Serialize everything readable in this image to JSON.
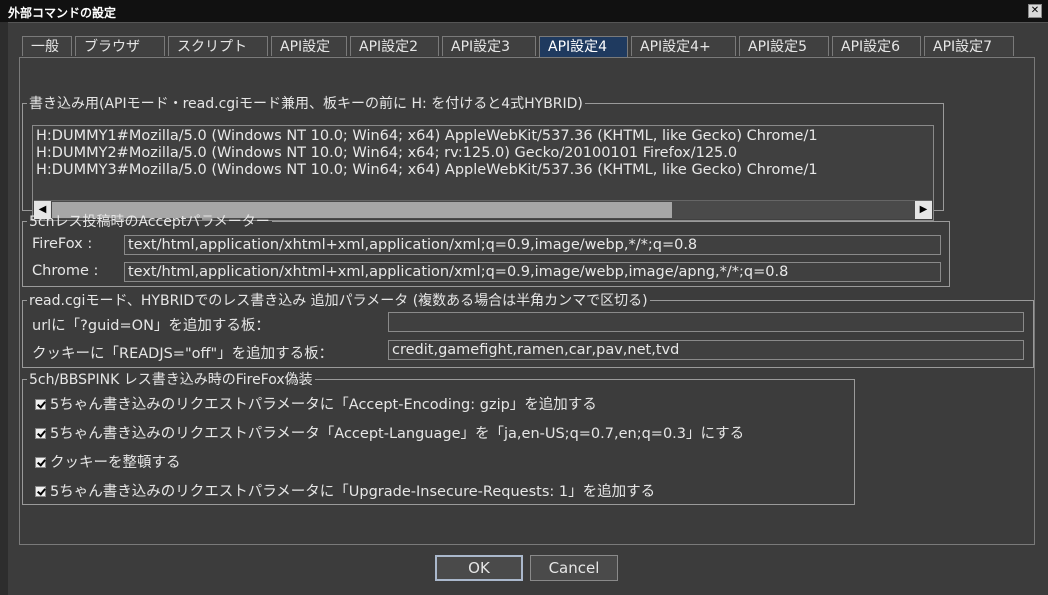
{
  "window": {
    "title": "外部コマンドの設定",
    "close_glyph": "✕"
  },
  "tabs": [
    {
      "label": "一般"
    },
    {
      "label": "ブラウザ"
    },
    {
      "label": "スクリプト"
    },
    {
      "label": "API設定"
    },
    {
      "label": "API設定2"
    },
    {
      "label": "API設定3"
    },
    {
      "label": "API設定4",
      "active": true
    },
    {
      "label": "API設定4+"
    },
    {
      "label": "API設定5"
    },
    {
      "label": "API設定6"
    },
    {
      "label": "API設定7"
    }
  ],
  "write_group": {
    "legend": "書き込み用(APIモード・read.cgiモード兼用、板キーの前に H: を付けると4式HYBRID)",
    "lines": [
      "H:DUMMY1#Mozilla/5.0 (Windows NT 10.0; Win64; x64) AppleWebKit/537.36 (KHTML, like Gecko) Chrome/1",
      "H:DUMMY2#Mozilla/5.0 (Windows NT 10.0; Win64; x64; rv:125.0) Gecko/20100101 Firefox/125.0",
      "H:DUMMY3#Mozilla/5.0 (Windows NT 10.0; Win64; x64) AppleWebKit/537.36 (KHTML, like Gecko) Chrome/1"
    ],
    "scroll_left": "◀",
    "scroll_right": "▶"
  },
  "accept_group": {
    "legend": "5chレス投稿時のAcceptパラメーター",
    "firefox_label": "FireFox :",
    "firefox_value": "text/html,application/xhtml+xml,application/xml;q=0.9,image/webp,*/*;q=0.8",
    "chrome_label": "Chrome :",
    "chrome_value": "text/html,application/xhtml+xml,application/xml;q=0.9,image/webp,image/apng,*/*;q=0.8"
  },
  "hybrid_group": {
    "legend": "read.cgiモード、HYBRIDでのレス書き込み 追加パラメータ (複数ある場合は半角カンマで区切る)",
    "guid_label": "urlに「?guid=ON」を追加する板：",
    "guid_value": "",
    "readjs_label": "クッキーに「READJS=\"off\"」を追加する板：",
    "readjs_value": "credit,gamefight,ramen,car,pav,net,tvd"
  },
  "firefox_group": {
    "legend": "5ch/BBSPINK レス書き込み時のFireFox偽装",
    "options": [
      {
        "label": "5ちゃん書き込みのリクエストパラメータに「Accept-Encoding: gzip」を追加する",
        "checked": true
      },
      {
        "label": "5ちゃん書き込みのリクエストパラメータ「Accept-Language」を「ja,en-US;q=0.7,en;q=0.3」にする",
        "checked": true
      },
      {
        "label": "クッキーを整頓する",
        "checked": true
      },
      {
        "label": "5ちゃん書き込みのリクエストパラメータに「Upgrade-Insecure-Requests: 1」を追加する",
        "checked": true
      }
    ]
  },
  "buttons": {
    "ok": "OK",
    "cancel": "Cancel"
  }
}
